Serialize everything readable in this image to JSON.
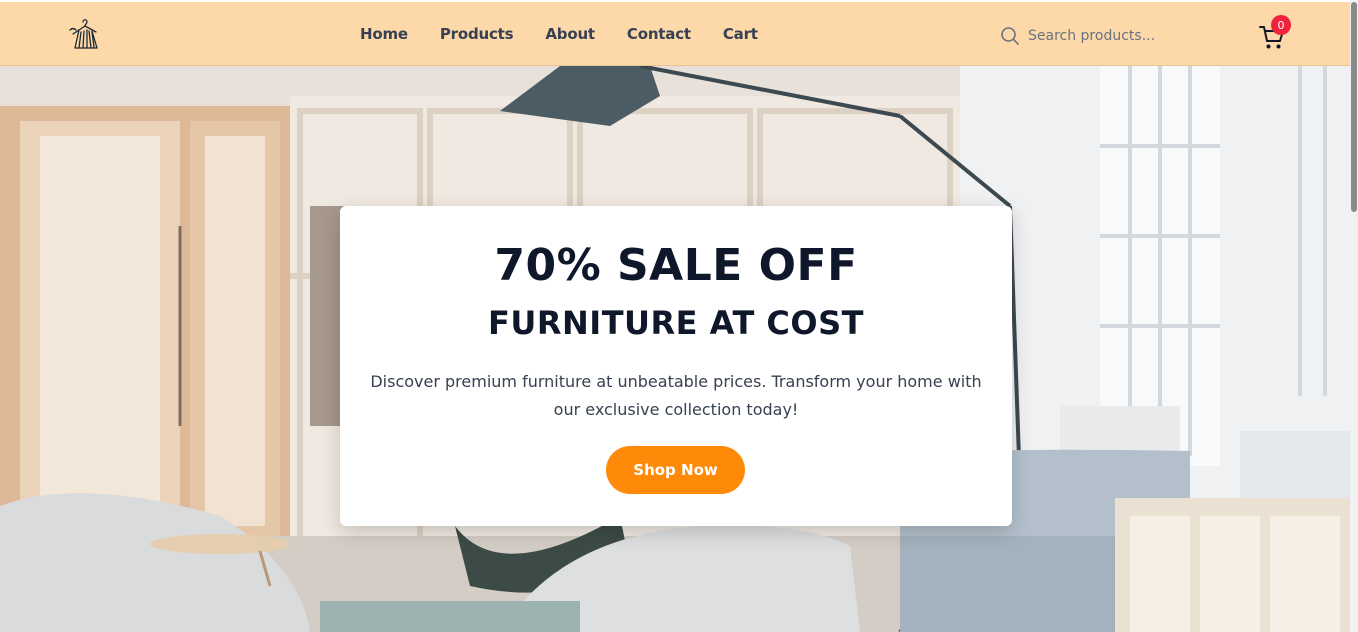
{
  "header": {
    "logo_icon": "clothes-hanger-dress-logo",
    "nav": [
      {
        "label": "Home"
      },
      {
        "label": "Products"
      },
      {
        "label": "About"
      },
      {
        "label": "Contact"
      },
      {
        "label": "Cart"
      }
    ],
    "search": {
      "placeholder": "Search products...",
      "value": "",
      "icon": "search-icon"
    },
    "cart": {
      "icon": "shopping-cart-icon",
      "count": "0"
    }
  },
  "hero": {
    "background_image": "bright furniture showroom with lamp, chairs and sofa",
    "headline": "70% SALE OFF",
    "subheadline": "FURNITURE AT COST",
    "description": "Discover premium furniture at unbeatable prices. Transform your home with our exclusive collection today!",
    "cta_label": "Shop Now"
  },
  "colors": {
    "header_bg": "#fdd8a8",
    "accent": "#ff8a0a",
    "badge": "#ef233c",
    "heading_text": "#0f172a",
    "body_text": "#374151"
  }
}
